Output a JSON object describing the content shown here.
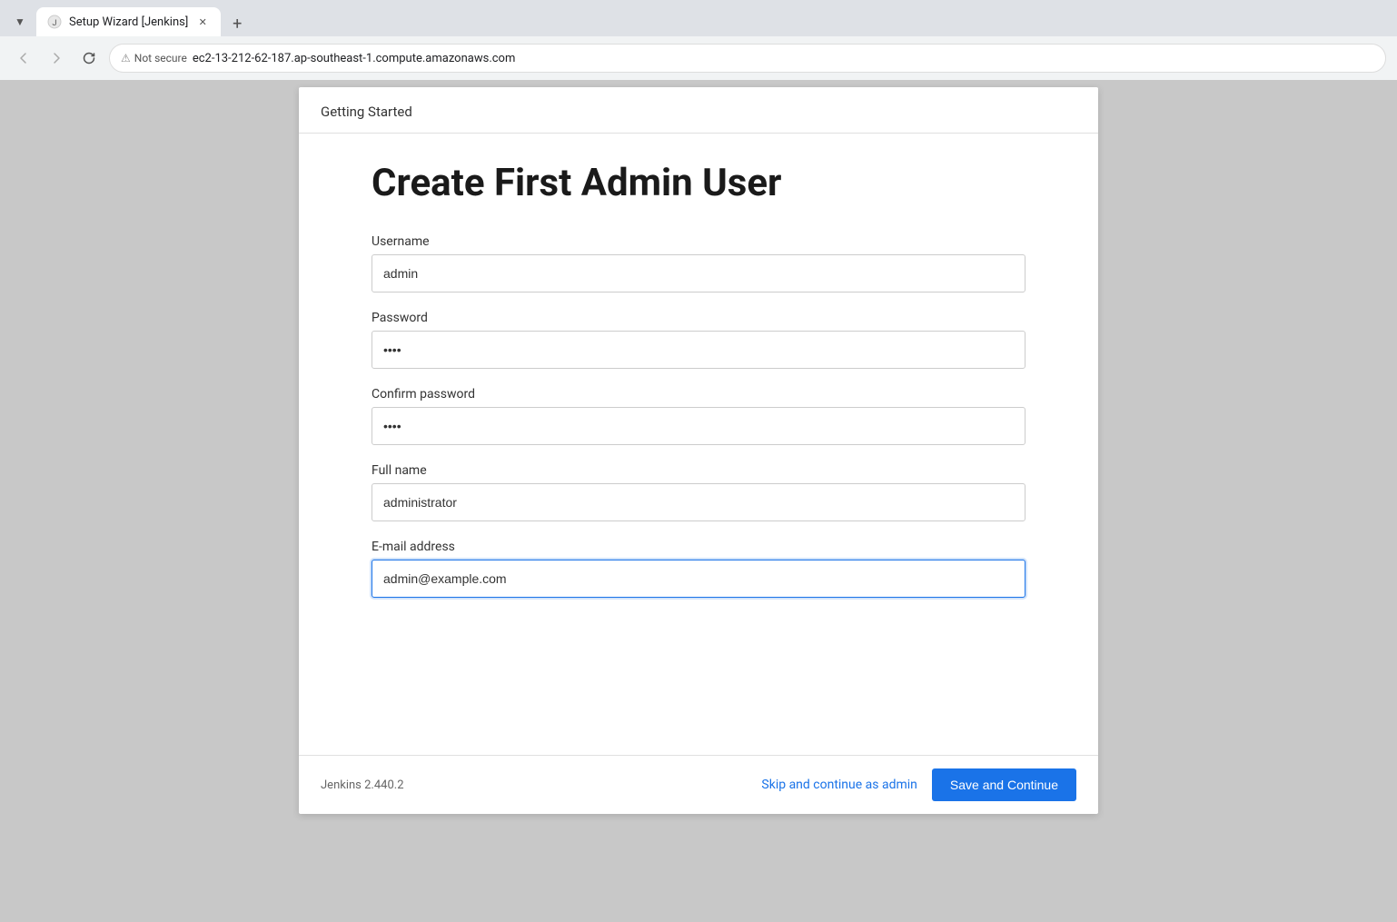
{
  "browser": {
    "tab_label": "Setup Wizard [Jenkins]",
    "new_tab_label": "+",
    "back_title": "Back",
    "forward_title": "Forward",
    "reload_title": "Reload",
    "security_label": "Not secure",
    "url": "ec2-13-212-62-187.ap-southeast-1.compute.amazonaws.com"
  },
  "wizard": {
    "header_title": "Getting Started",
    "page_title": "Create First Admin User",
    "fields": {
      "username_label": "Username",
      "username_value": "admin",
      "password_label": "Password",
      "password_value": "••••",
      "confirm_password_label": "Confirm password",
      "confirm_password_value": "••••",
      "fullname_label": "Full name",
      "fullname_value": "administrator",
      "email_label": "E-mail address",
      "email_value": "admin@example.com"
    },
    "footer": {
      "version": "Jenkins 2.440.2",
      "skip_label": "Skip and continue as admin",
      "save_label": "Save and Continue"
    }
  }
}
